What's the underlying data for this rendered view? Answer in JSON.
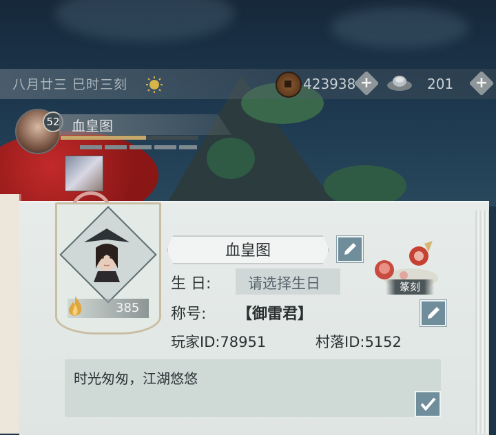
{
  "topbar": {
    "date": "八月廿三  巳时三刻",
    "coins": "423938",
    "ingots": "201",
    "plus_symbol": "+"
  },
  "player": {
    "level": "52",
    "name": "血皇图",
    "exp_progress": 0.62
  },
  "profile": {
    "power": "385",
    "name": "血皇图",
    "birthday_label": "生  日:",
    "birthday_value": "请选择生日",
    "title_label": "称号:",
    "title_value": "【御雷君】",
    "player_id": "玩家ID:78951",
    "village_id": "村落ID:5152",
    "emblem_label": "篆刻",
    "motto": "时光匆匆，江湖悠悠"
  },
  "colors": {
    "accent_button": "#6f8d9a",
    "panel_bg": "#e7ecea",
    "red_tree": "#c22a2a"
  },
  "icons": [
    "sun-icon",
    "copper-coin-icon",
    "silver-ingot-icon",
    "plus-icon",
    "edit-icon",
    "flame-icon",
    "check-icon",
    "seal-emblem-icon"
  ]
}
